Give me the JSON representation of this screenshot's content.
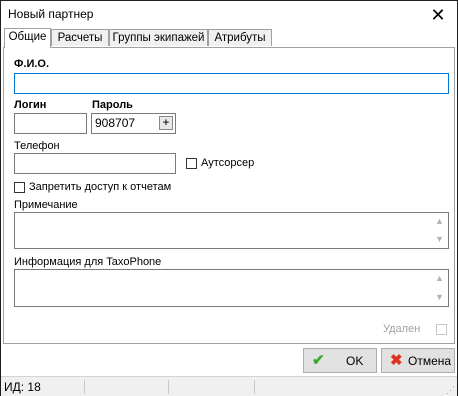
{
  "window": {
    "title": "Новый партнер",
    "close_glyph": "✕"
  },
  "tabs": [
    {
      "label": "Общие",
      "active": true
    },
    {
      "label": "Расчеты",
      "active": false
    },
    {
      "label": "Группы экипажей",
      "active": false
    },
    {
      "label": "Атрибуты",
      "active": false
    }
  ],
  "form": {
    "fio_label": "Ф.И.О.",
    "fio_value": "",
    "login_label": "Логин",
    "login_value": "",
    "password_label": "Пароль",
    "password_value": "908707",
    "password_generate_glyph": "+",
    "phone_label": "Телефон",
    "phone_value": "",
    "outsourcer_label": "Аутсорсер",
    "outsourcer_checked": false,
    "deny_reports_label": "Запретить доступ к отчетам",
    "deny_reports_checked": false,
    "note_label": "Примечание",
    "note_value": "",
    "taxophone_label": "Информация для TaxoPhone",
    "taxophone_value": "",
    "deleted_label": "Удален",
    "deleted_checked": false
  },
  "buttons": {
    "ok_label": "OK",
    "ok_icon": "check-icon",
    "cancel_label": "Отмена",
    "cancel_icon": "cross-icon"
  },
  "status": {
    "id_text": "ИД: 18"
  },
  "colors": {
    "focus_border": "#0078d7",
    "ok_icon": "#3aa835",
    "cancel_icon": "#e0301e"
  }
}
